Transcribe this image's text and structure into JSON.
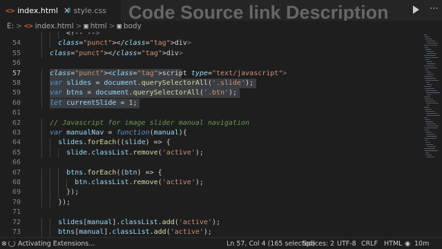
{
  "tabs": [
    {
      "icon": "<>",
      "label": "index.html",
      "close": "×"
    },
    {
      "icon": "#",
      "label": "style.css"
    }
  ],
  "overlay_title": "Code Source link Description",
  "breadcrumb": {
    "drive": "E:",
    "sep": ">",
    "file": "index.html",
    "html": "html",
    "body": "body"
  },
  "editor": {
    "lines": [
      {
        "n": "",
        "text": "        <!-- -->"
      },
      {
        "n": "54",
        "text": "      </div>"
      },
      {
        "n": "55",
        "text": "    </div>"
      },
      {
        "n": "56",
        "text": ""
      },
      {
        "n": "57",
        "text": "    <script type=\"text/javascript\">"
      },
      {
        "n": "58",
        "text": "    var slides = document.querySelectorAll('.slide');"
      },
      {
        "n": "59",
        "text": "    var btns = document.querySelectorAll('.btn');"
      },
      {
        "n": "60",
        "text": "    let currentSlide = 1;"
      },
      {
        "n": "61",
        "text": ""
      },
      {
        "n": "62",
        "text": "    // Javascript for image slider manual navigation"
      },
      {
        "n": "63",
        "text": "    var manualNav = function(manual){"
      },
      {
        "n": "64",
        "text": "      slides.forEach((slide) => {"
      },
      {
        "n": "65",
        "text": "        slide.classList.remove('active');"
      },
      {
        "n": "66",
        "text": ""
      },
      {
        "n": "67",
        "text": "        btns.forEach((btn) => {"
      },
      {
        "n": "68",
        "text": "          btn.classList.remove('active');"
      },
      {
        "n": "69",
        "text": "        });"
      },
      {
        "n": "70",
        "text": "      });"
      },
      {
        "n": "71",
        "text": ""
      },
      {
        "n": "72",
        "text": "      slides[manual].classList.add('active');"
      },
      {
        "n": "73",
        "text": "      btns[manual].classList.add('active');"
      }
    ]
  },
  "status": {
    "left_icon": "⊗",
    "left_count": "0",
    "activity": "Activating Extensions...",
    "position": "Ln 57, Col 4 (165 selected)",
    "spaces": "Spaces: 2",
    "encoding": "UTF-8",
    "eol": "CRLF",
    "language": "HTML",
    "broadcast": "10m"
  },
  "colors": {
    "keyword": "#569cd6",
    "string": "#ce9178",
    "function": "#dcdcaa",
    "variable": "#9cdcfe",
    "comment": "#6a9955",
    "selection": "#3a3d41"
  }
}
